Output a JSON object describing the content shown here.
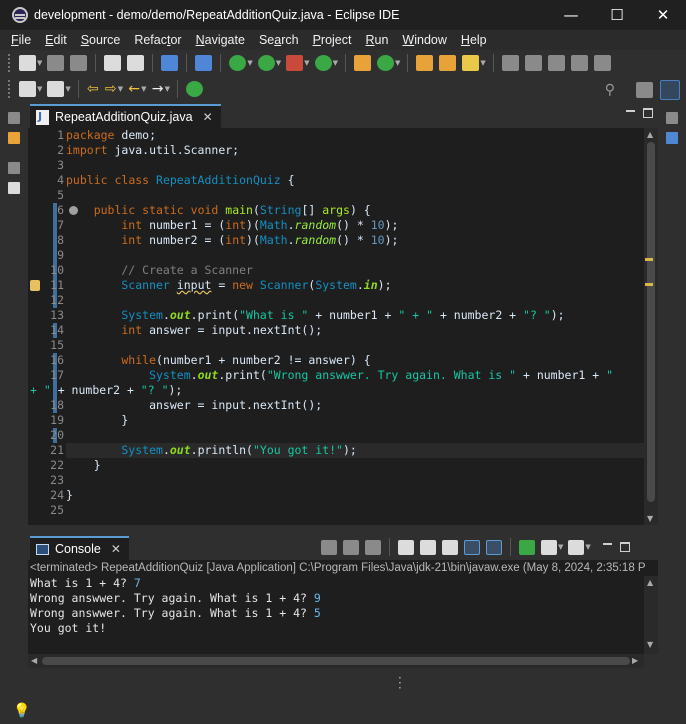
{
  "window": {
    "title": "development - demo/demo/RepeatAdditionQuiz.java - Eclipse IDE",
    "minimize": "—",
    "maximize": "☐",
    "close": "✕"
  },
  "menu": [
    {
      "u": "F",
      "rest": "ile"
    },
    {
      "u": "E",
      "rest": "dit"
    },
    {
      "u": "S",
      "rest": "ource"
    },
    {
      "u": "",
      "pre": "Refac",
      "uu": "t",
      "rest": "or"
    },
    {
      "u": "N",
      "rest": "avigate"
    },
    {
      "u": "",
      "pre": "Se",
      "uu": "a",
      "rest": "rch"
    },
    {
      "u": "P",
      "rest": "roject"
    },
    {
      "u": "R",
      "rest": "un"
    },
    {
      "u": "W",
      "rest": "indow"
    },
    {
      "u": "H",
      "rest": "elp"
    }
  ],
  "editor": {
    "tab_label": "RepeatAdditionQuiz.java",
    "line_numbers": [
      "1",
      "2",
      "3",
      "4",
      "5",
      "6",
      "7",
      "8",
      "9",
      "10",
      "11",
      "12",
      "13",
      "14",
      "15",
      "16",
      "17",
      "",
      "18",
      "19",
      "20",
      "21",
      "22",
      "23",
      "24",
      "25"
    ],
    "lines": {
      "l1_kw": "package",
      "l1_rest": " demo;",
      "l2_kw": "import",
      "l2_rest": " java.util.Scanner;",
      "l4_kw1": "public",
      "l4_kw2": " class",
      "l4_name": " RepeatAdditionQuiz",
      "l4_rest": " {",
      "l6_kw1": "    public",
      "l6_kw2": " static",
      "l6_kw3": " void",
      "l6_fn": " main",
      "l6_p1": "(",
      "l6_ty": "String",
      "l6_p2": "[] ",
      "l6_arg": "args",
      "l6_p3": ") {",
      "l7_kw": "        int",
      "l7_a": " number1 = (",
      "l7_int": "int",
      "l7_b": ")(",
      "l7_cls": "Math",
      "l7_dot": ".",
      "l7_fn": "random",
      "l7_c": "() * ",
      "l7_num": "10",
      "l7_d": ");",
      "l8_kw": "        int",
      "l8_a": " number2 = (",
      "l8_int": "int",
      "l8_b": ")(",
      "l8_cls": "Math",
      "l8_dot": ".",
      "l8_fn": "random",
      "l8_c": "() * ",
      "l8_num": "10",
      "l8_d": ");",
      "l10_cm": "        // Create a Scanner",
      "l11_ty": "        Scanner",
      "l11_var": "input",
      "l11_a": " = ",
      "l11_new": "new",
      "l11_ty2": " Scanner",
      "l11_b": "(",
      "l11_sys": "System",
      "l11_dot": ".",
      "l11_fld": "in",
      "l11_c": ");",
      "l13_sys": "        System",
      "l13_dot": ".",
      "l13_fld": "out",
      "l13_a": ".print(",
      "l13_s1": "\"What is \"",
      "l13_b": " + number1 + ",
      "l13_s2": "\" + \"",
      "l13_c": " + number2 + ",
      "l13_s3": "\"? \"",
      "l13_d": ");",
      "l14_kw": "        int",
      "l14_rest": " answer = input.nextInt();",
      "l16_kw": "        while",
      "l16_rest": "(number1 + number2 != answer) {",
      "l17_sys": "            System",
      "l17_dot": ".",
      "l17_fld": "out",
      "l17_a": ".print(",
      "l17_s1": "\"Wrong answwer. Try again. What is \"",
      "l17_b": " + number1 + ",
      "l17_s2": "\"",
      "l17w_s": "+ \"",
      "l17w_a": " + number2 + ",
      "l17w_s2": "\"? \"",
      "l17w_b": ");",
      "l18_rest": "            answer = input.nextInt();",
      "l19_rest": "        }",
      "l21_sys": "        System",
      "l21_dot": ".",
      "l21_fld": "out",
      "l21_a": ".println(",
      "l21_s": "\"You got it!\"",
      "l21_b": ");",
      "l22_rest": "    }",
      "l24_rest": "}"
    }
  },
  "console": {
    "tab_label": "Console",
    "status": "<terminated> RepeatAdditionQuiz [Java Application] C:\\Program Files\\Java\\jdk-21\\bin\\javaw.exe  (May 8, 2024, 2:35:18 P",
    "output": [
      {
        "text": "What is 1 + 4? ",
        "input": "7"
      },
      {
        "text": "Wrong answwer. Try again. What is 1 + 4? ",
        "input": "9"
      },
      {
        "text": "Wrong answwer. Try again. What is 1 + 4? ",
        "input": "5"
      },
      {
        "text": "You got it!",
        "input": ""
      }
    ]
  },
  "icons": {
    "search": "search-icon",
    "bulb": "lightbulb-icon"
  }
}
